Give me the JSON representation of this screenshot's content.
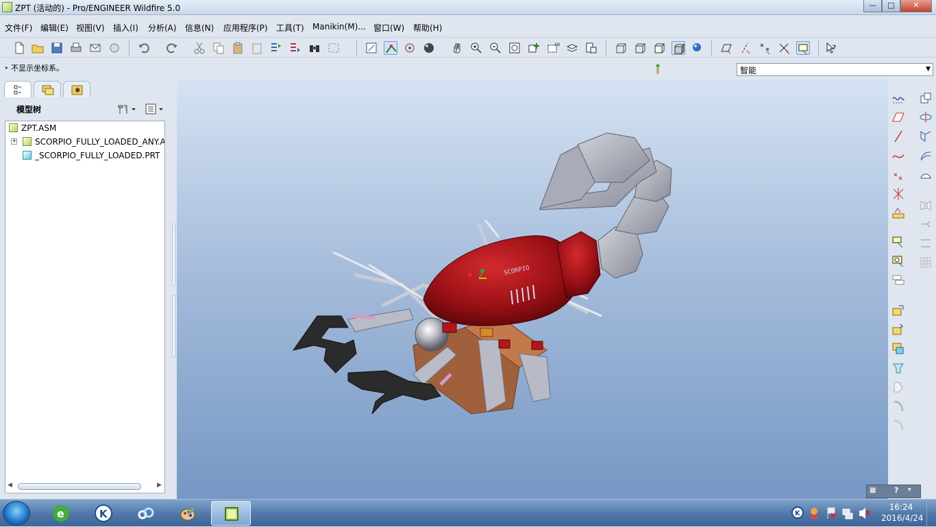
{
  "window": {
    "title": "ZPT (活动的) - Pro/ENGINEER Wildfire 5.0",
    "controls": {
      "minimize": "—",
      "maximize": "□",
      "close": "✕"
    }
  },
  "menu": [
    "文件(F)",
    "编辑(E)",
    "视图(V)",
    "插入(I)",
    "分析(A)",
    "信息(N)",
    "应用程序(P)",
    "工具(T)",
    "Manikin(M)...",
    "窗口(W)",
    "帮助(H)"
  ],
  "status": {
    "message": "不显示坐标系。",
    "filter_value": "智能"
  },
  "navigator": {
    "title": "模型树",
    "tabs": [
      "model-tree-icon",
      "folder-browser-icon",
      "favorites-icon"
    ],
    "tree": [
      {
        "label": "ZPT.ASM",
        "type": "asm"
      },
      {
        "label": "SCORPIO_FULLY_LOADED_ANY.A",
        "type": "asm"
      },
      {
        "label": "_SCORPIO_FULLY_LOADED.PRT",
        "type": "prt"
      }
    ]
  },
  "colors": {
    "body_red": "#9b1116",
    "claw_dark": "#2b2b2b",
    "shell_gray": "#a7a9b4",
    "box_brown": "#a0603b"
  },
  "model_label": "SCORPIO",
  "taskbar": {
    "apps": [
      "start-orb",
      "green-e-icon",
      "k-app-icon",
      "cloud-app-icon",
      "paint-icon",
      "proe-window-icon"
    ],
    "time": "16:24",
    "date": "2016/4/24"
  }
}
